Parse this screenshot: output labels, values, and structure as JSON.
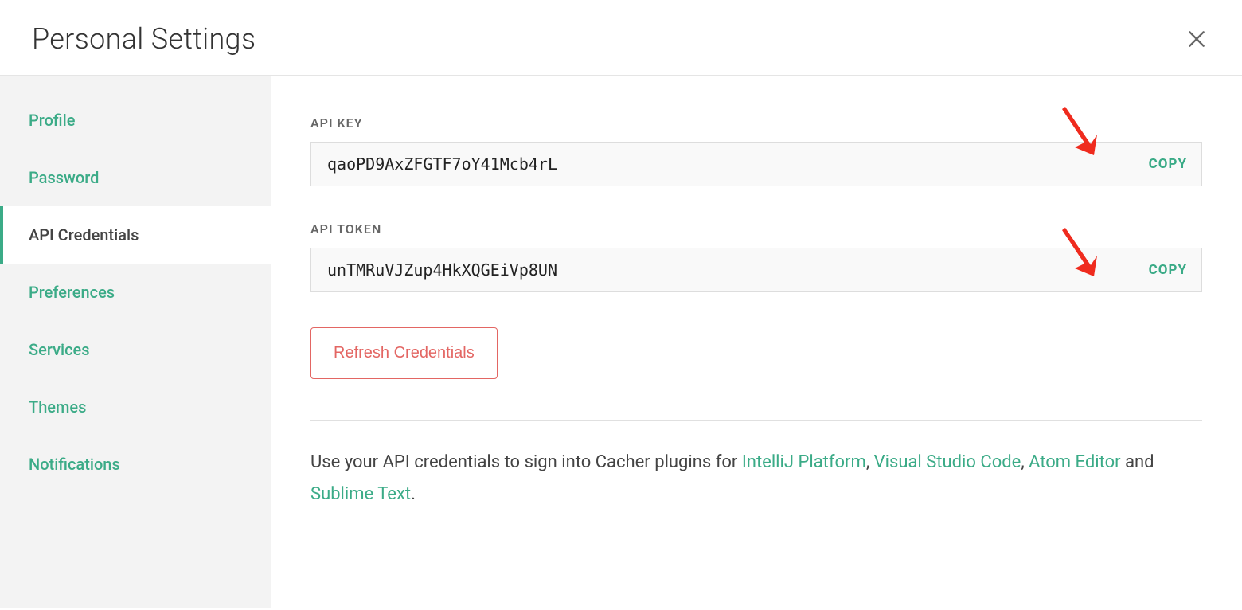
{
  "header": {
    "title": "Personal Settings"
  },
  "sidebar": {
    "items": [
      {
        "label": "Profile"
      },
      {
        "label": "Password"
      },
      {
        "label": "API Credentials"
      },
      {
        "label": "Preferences"
      },
      {
        "label": "Services"
      },
      {
        "label": "Themes"
      },
      {
        "label": "Notifications"
      }
    ]
  },
  "main": {
    "api_key_label": "API KEY",
    "api_key_value": "qaoPD9AxZFGTF7oY41Mcb4rL",
    "api_token_label": "API TOKEN",
    "api_token_value": "unTMRuVJZup4HkXQGEiVp8UN",
    "copy_label": "COPY",
    "refresh_label": "Refresh Credentials",
    "help_prefix": "Use your API credentials to sign into Cacher plugins for ",
    "link_intellij": "IntelliJ Platform",
    "sep1": ", ",
    "link_vscode": "Visual Studio Code",
    "sep2": ", ",
    "link_atom": "Atom Editor",
    "and": " and ",
    "link_sublime": "Sublime Text",
    "period": "."
  },
  "colors": {
    "accent": "#3bab87",
    "danger": "#e36663",
    "annotation": "#ef2b1e"
  }
}
